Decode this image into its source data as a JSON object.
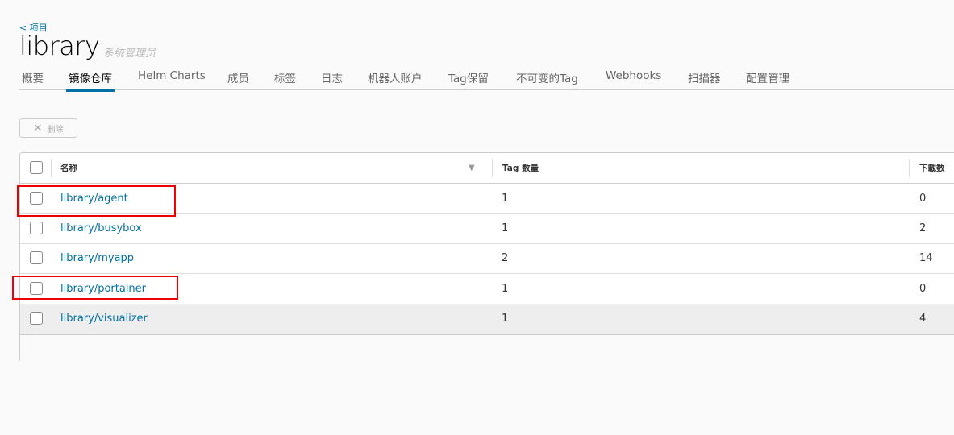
{
  "breadcrumb": "< 项目",
  "title": "library",
  "role": "系统管理员",
  "tabs": [
    "概要",
    "镜像仓库",
    "Helm Charts",
    "成员",
    "标签",
    "日志",
    "机器人账户",
    "Tag保留",
    "不可变的Tag",
    "Webhooks",
    "扫描器",
    "配置管理"
  ],
  "active_tab": 1,
  "delete_label": "删除",
  "columns": {
    "name": "名称",
    "tags": "Tag 数量",
    "downloads": "下載数"
  },
  "rows": [
    {
      "name": "library/agent",
      "tags": "1",
      "downloads": "0"
    },
    {
      "name": "library/busybox",
      "tags": "1",
      "downloads": "2"
    },
    {
      "name": "library/myapp",
      "tags": "2",
      "downloads": "14"
    },
    {
      "name": "library/portainer",
      "tags": "1",
      "downloads": "0"
    },
    {
      "name": "library/visualizer",
      "tags": "1",
      "downloads": "4"
    }
  ]
}
